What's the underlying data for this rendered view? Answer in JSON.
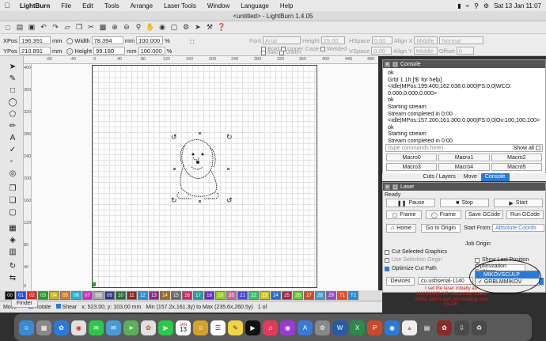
{
  "menubar": {
    "items": [
      "LightBurn",
      "File",
      "Edit",
      "Tools",
      "Arrange",
      "Laser Tools",
      "Window",
      "Language",
      "Help"
    ],
    "clock": "Sat 13 Jan  11:07"
  },
  "window": {
    "title": "<untitled> - LightBurn 1.4.05"
  },
  "props": {
    "xpos_label": "XPos",
    "xpos": "196.391",
    "ypos_label": "YPos",
    "ypos": "210.891",
    "unit": "mm",
    "width_label": "Width",
    "width": "78.394",
    "height_label": "Height",
    "height": "99.180",
    "pct": "100.000",
    "pct_unit": "%",
    "font_label": "Font",
    "font": "Arial",
    "fheight_label": "Height",
    "fheight": "25.00",
    "hspace_label": "HSpace",
    "hspace": "0.00",
    "alignx_label": "Align X",
    "alignx": "Middle",
    "normal": "Normal",
    "vspace_label": "VSpace",
    "vspace": "0.00",
    "aligny_label": "Align Y",
    "aligny": "Middle",
    "offset_label": "Offset",
    "offset": "0",
    "bold": "Bold",
    "upper_case": "Upper Case",
    "welded": "Welded",
    "italic": "Italic",
    "distort": "Distort"
  },
  "ruler": {
    "top": [
      "-80",
      "-40",
      "0",
      "40",
      "80",
      "120",
      "160",
      "200",
      "240",
      "280",
      "320",
      "360",
      "400",
      "440",
      "480"
    ],
    "left": [
      "400",
      "360",
      "320",
      "280",
      "240",
      "200",
      "160",
      "120",
      "80",
      "40",
      "0"
    ]
  },
  "console": {
    "title": "Console",
    "lines": [
      "ok",
      "Grbl 1.1h ['$' for help]",
      "<Idle|MPos:199.400,162.038,0.000|FS:0,0|WCO:",
      "0.000,0.000,0.000>",
      "ok",
      "Starting stream",
      "Stream completed in 0:00",
      "<Idle|MPos:157.200,161.300,0.000|FS:0,0|Ov:100,100,100>",
      "ok",
      "Starting stream",
      "Stream completed in 0:00"
    ],
    "input_placeholder": "(type commands here)",
    "show_all": "Show all",
    "macros": [
      "Macro0",
      "Macro1",
      "Macro2",
      "Macro3",
      "Macro4",
      "Macro5"
    ],
    "tabs": [
      "Cuts / Layers",
      "Move",
      "Console"
    ]
  },
  "laser": {
    "title": "Laser",
    "state": "Ready",
    "pause": "Pause",
    "stop": "Stop",
    "start": "Start",
    "frame1": "Frame",
    "frame2": "Frame",
    "save_gcode": "Save GCode",
    "run_gcode": "Run GCode",
    "home": "Home",
    "go_to_origin": "Go to Origin",
    "start_from_label": "Start From:",
    "start_from": "Absolute Coords",
    "job_origin": "Job Origin",
    "cut_selected": "Cut Selected Graphics",
    "use_selection_origin": "Use Selection Origin",
    "show_last_position": "Show Last Position",
    "optimize": "Optimize Cut Path",
    "optimization_settings": "Optimization Settings",
    "devices": "Devices",
    "port": "cu.usbserial-1140",
    "device_options": [
      "MIKOVSCULP",
      "GRBLMMIKOV"
    ],
    "note": "I set the laser initially as MIKOVSCULP. Yesterday I tried GRBL and it was not working now it's OK"
  },
  "palette": [
    "00",
    "01",
    "02",
    "03",
    "04",
    "05",
    "06",
    "07",
    "08",
    "09",
    "10",
    "11",
    "12",
    "13",
    "14",
    "15",
    "16",
    "17",
    "18",
    "19",
    "20",
    "21",
    "22",
    "23",
    "24",
    "25",
    "26",
    "27",
    "28",
    "29",
    "T1",
    "T2"
  ],
  "status": {
    "move": "Move",
    "rotate": "Rotate",
    "shear": "Shear",
    "coords": "x: 523.00, y: 103.00 mm",
    "range": "Min (157.2x,161.3y) to Max (235.6x,260.5y)",
    "count": "1 ol",
    "finder": "Finder"
  },
  "dock": {
    "calendar_month": "JAN",
    "calendar_day": "13"
  },
  "colors": {
    "accent": "#2a7ad6",
    "note": "#d02020"
  }
}
